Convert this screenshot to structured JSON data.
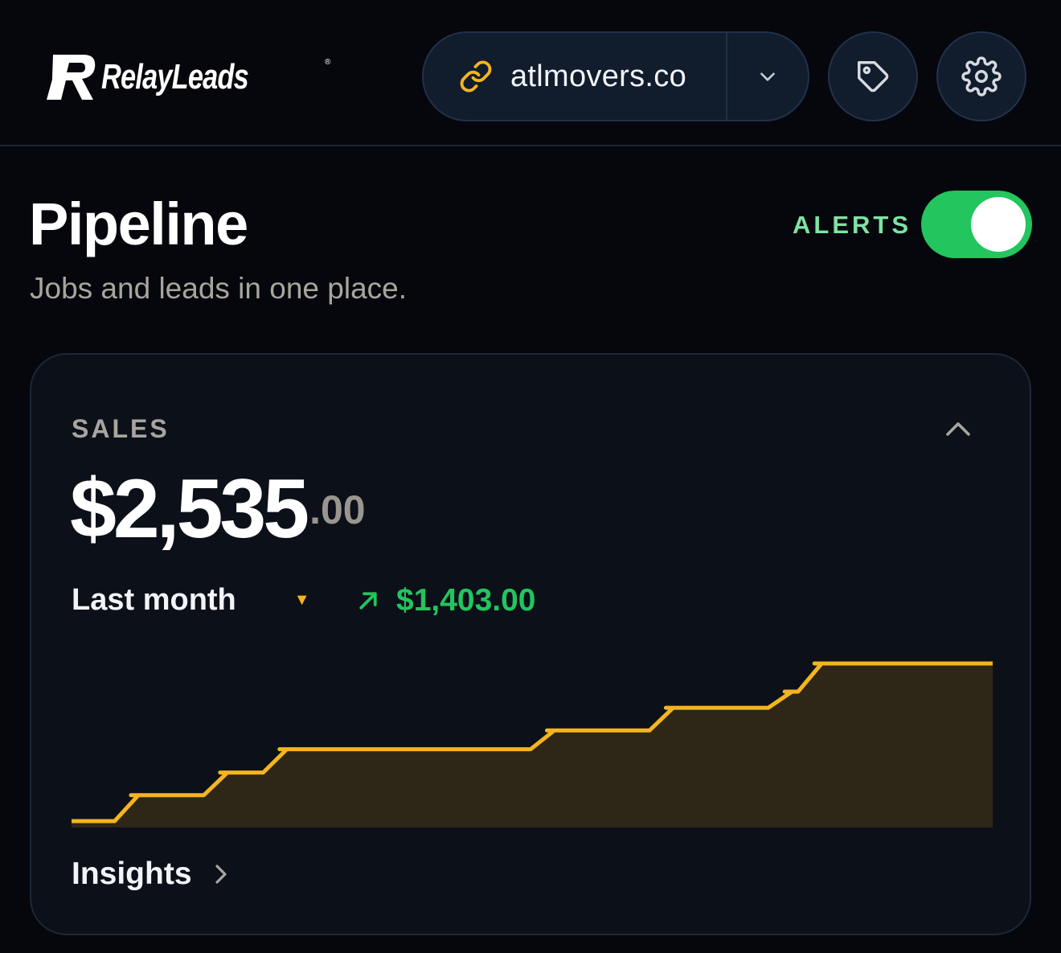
{
  "header": {
    "brand": "RelayLeads",
    "brand_mark": "®",
    "domain": "atlmovers.co",
    "icons": {
      "link": "link-icon",
      "dropdown": "chevron-down-icon",
      "tag": "tag-icon",
      "settings": "gear-icon"
    }
  },
  "page": {
    "title": "Pipeline",
    "subtitle": "Jobs and leads in one place.",
    "alerts_label": "ALERTS",
    "alerts_on": true
  },
  "sales_card": {
    "label": "SALES",
    "amount_main": "$2,535",
    "amount_cents": ".00",
    "period": "Last month",
    "period_caret": "▼",
    "delta": "$1,403.00",
    "insights_label": "Insights"
  },
  "colors": {
    "accent_yellow": "#f4b51e",
    "positive_green": "#22c55e",
    "alerts_text": "#7ee3a4",
    "background": "#05070c",
    "card": "#0c1019"
  },
  "chart_data": {
    "type": "area",
    "title": "",
    "xlabel": "",
    "ylabel": "",
    "grid": false,
    "legend": "none",
    "interpolation": "step",
    "ylim": [
      0,
      2535
    ],
    "x": [
      0,
      1,
      2,
      3,
      4,
      5,
      6,
      7,
      8,
      9,
      10,
      11,
      12,
      13,
      14,
      15,
      16,
      17,
      18,
      19,
      20,
      21,
      22,
      23,
      24,
      25,
      26,
      27,
      28,
      29,
      30,
      31
    ],
    "series": [
      {
        "values": [
          100,
          100,
          500,
          500,
          500,
          850,
          850,
          1210,
          1210,
          1210,
          1210,
          1210,
          1210,
          1210,
          1210,
          1210,
          1500,
          1500,
          1500,
          1500,
          1850,
          1850,
          1850,
          1850,
          2100,
          2535,
          2535,
          2535,
          2535,
          2535,
          2535,
          2535
        ],
        "color": "#f4b51e"
      }
    ]
  }
}
